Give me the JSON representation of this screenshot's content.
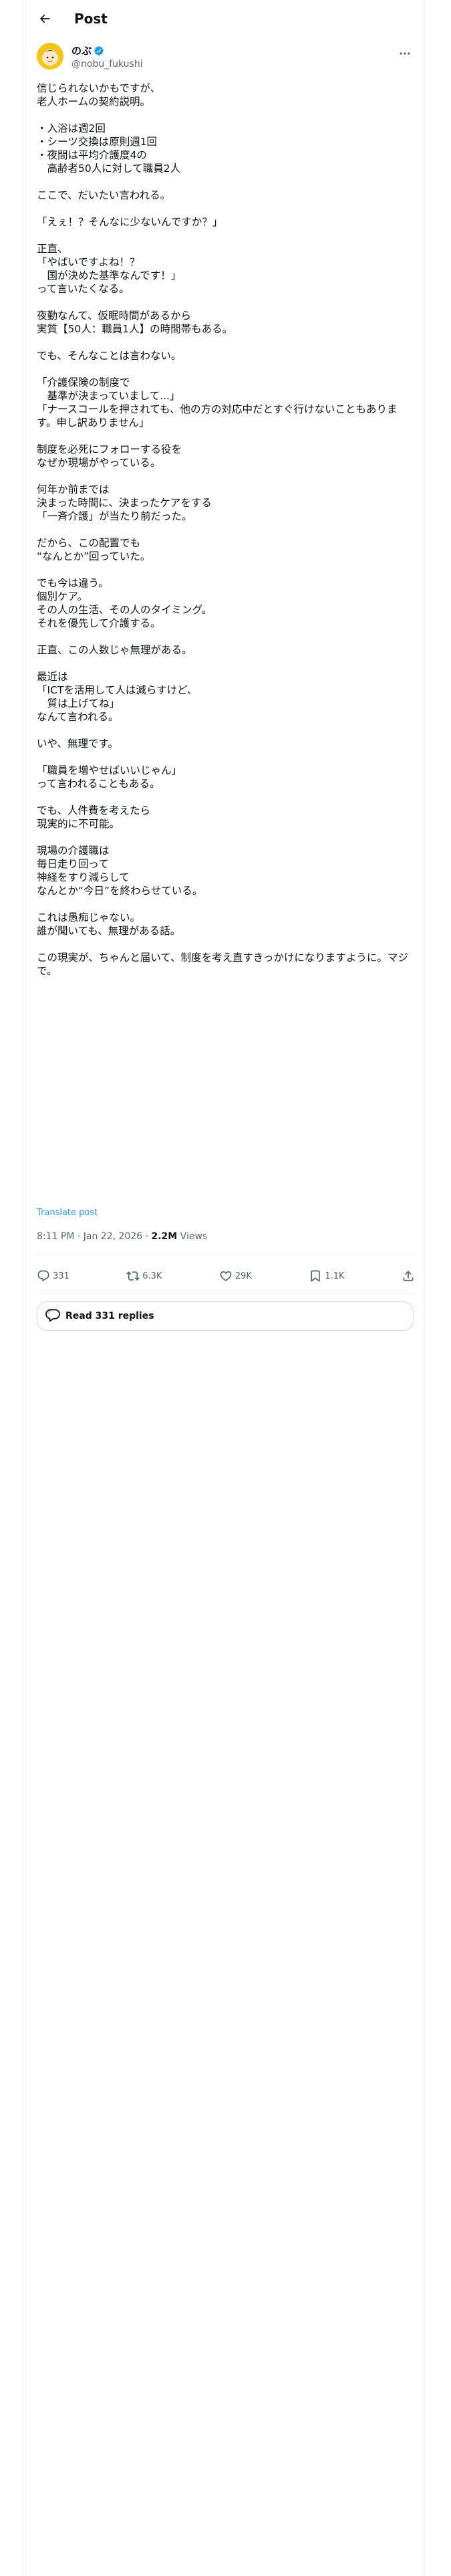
{
  "header": {
    "title": "Post"
  },
  "author": {
    "name": "のぶ",
    "handle": "@nobu_fukushi"
  },
  "post": {
    "lines": [
      "信じられないかもですが、",
      "老人ホームの契約説明。",
      "",
      "・入浴は週2回",
      "・シーツ交換は原則週1回",
      "・夜間は平均介護度4の",
      "　高齢者50人に対して職員2人",
      "",
      "ここで、だいたい言われる。",
      "",
      "「えぇ！？そんなに少ないんですか？」",
      "",
      "正直、",
      "「やばいですよね！？",
      "　国が決めた基準なんです！」",
      "って言いたくなる。",
      "",
      "夜勤なんて、仮眠時間があるから",
      "実質【50人：職員1人】の時間帯もある。",
      "",
      "でも、そんなことは言わない。",
      "",
      "「介護保険の制度で",
      "　基準が決まっていまして...」",
      "「ナースコールを押されても、他の方の対応中だとすぐ行けないこともあります。申し訳ありません」",
      "",
      "制度を必死にフォローする役を",
      "なぜか現場がやっている。",
      "",
      "何年か前までは",
      "決まった時間に、決まったケアをする",
      "「一斉介護」が当たり前だった。",
      "",
      "だから、この配置でも",
      "“なんとか”回っていた。",
      "",
      "でも今は違う。",
      "個別ケア。",
      "その人の生活、その人のタイミング。",
      "それを優先して介護する。",
      "",
      "正直、この人数じゃ無理がある。",
      "",
      "最近は",
      "「ICTを活用して人は減らすけど、",
      "　質は上げてね」",
      "なんて言われる。",
      "",
      "いや、無理です。",
      "",
      "「職員を増やせばいいじゃん」",
      "って言われることもある。",
      "",
      "でも、人件費を考えたら",
      "現実的に不可能。",
      "",
      "現場の介護職は",
      "毎日走り回って",
      "神経をすり減らして",
      "なんとか“今日”を終わらせている。",
      "",
      "これは愚痴じゃない。",
      "誰が聞いても、無理がある話。",
      "",
      "この現実が、ちゃんと届いて、制度を考え直すきっかけになりますように。マジで。"
    ],
    "translate_label": "Translate post",
    "time": "8:11 PM · Jan 22, 2026",
    "separator": " · ",
    "views_count": "2.2M",
    "views_label": " Views"
  },
  "actions": {
    "replies": "331",
    "reposts": "6.3K",
    "likes": "29K",
    "bookmarks": "1.1K"
  },
  "read_replies": {
    "label": "Read 331 replies"
  },
  "colors": {
    "accent": "#1d9bf0",
    "secondary_text": "#536471",
    "avatar_bg": "#f5c518"
  }
}
